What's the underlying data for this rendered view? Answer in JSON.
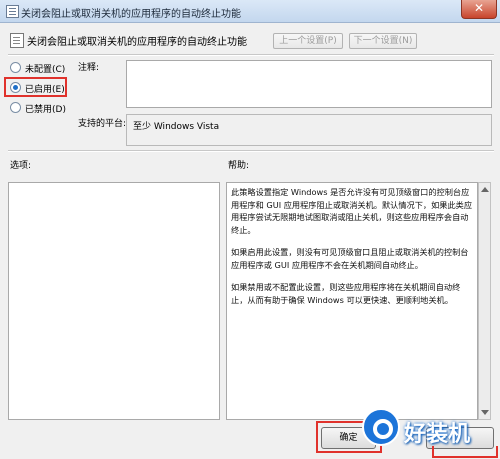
{
  "window": {
    "title": "关闭会阻止或取消关机的应用程序的自动终止功能",
    "close_glyph": "✕"
  },
  "header": {
    "title": "关闭会阻止或取消关机的应用程序的自动终止功能",
    "prev_label": "上一个设置(P)",
    "next_label": "下一个设置(N)"
  },
  "state": {
    "options": [
      {
        "label": "未配置(C)",
        "selected": false
      },
      {
        "label": "已启用(E)",
        "selected": true
      },
      {
        "label": "已禁用(D)",
        "selected": false
      }
    ]
  },
  "comment": {
    "label": "注释:",
    "value": ""
  },
  "platform": {
    "label": "支持的平台:",
    "value": "至少 Windows Vista"
  },
  "sections": {
    "options_label": "选项:",
    "help_label": "帮助:"
  },
  "help": {
    "paragraphs": [
      "此策略设置指定 Windows 是否允许没有可见顶级窗口的控制台应用程序和 GUI 应用程序阻止或取消关机。默认情况下，如果此类应用程序尝试无限期地试图取消或阻止关机，则这些应用程序会自动终止。",
      "如果启用此设置，则没有可见顶级窗口且阻止或取消关机的控制台应用程序或 GUI 应用程序不会在关机期间自动终止。",
      "如果禁用或不配置此设置，则这些应用程序将在关机期间自动终止，从而有助于确保 Windows 可以更快速、更顺利地关机。"
    ]
  },
  "buttons": {
    "ok_label": "确定"
  },
  "watermark": {
    "text": "好装机"
  },
  "colors": {
    "highlight": "#e0322c",
    "accent": "#1c74d9"
  }
}
